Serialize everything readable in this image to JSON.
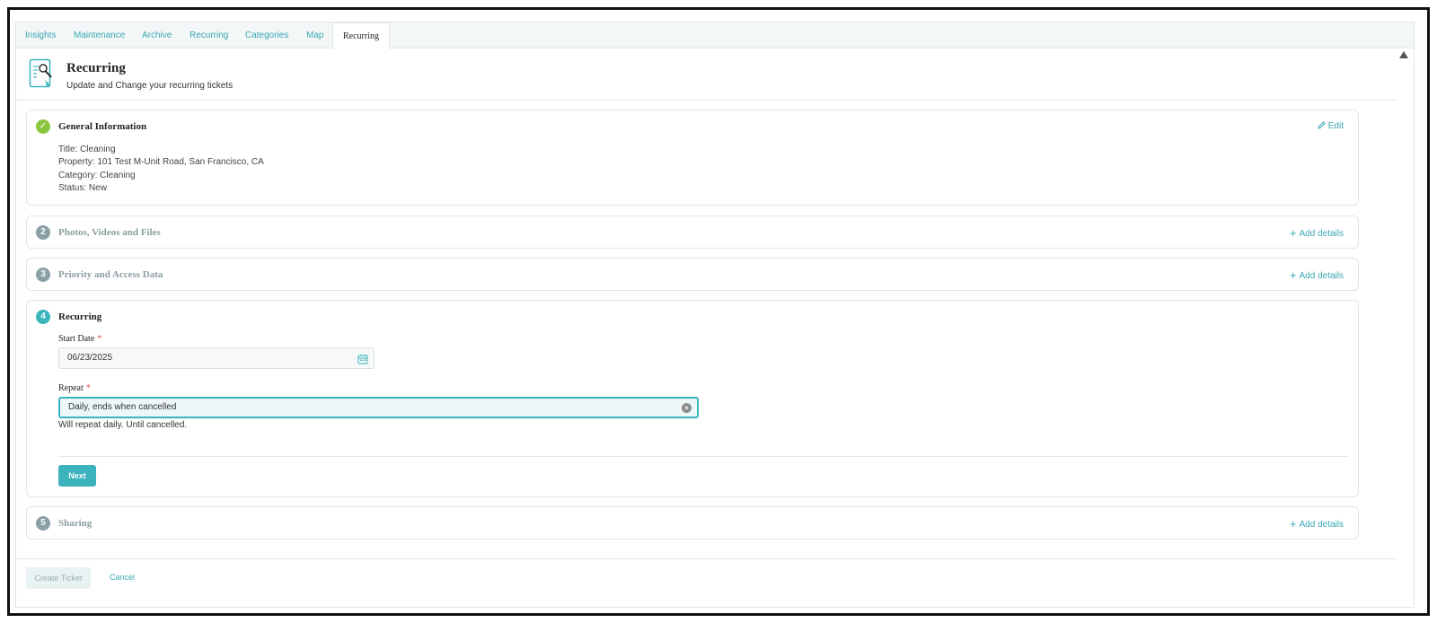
{
  "tabs": [
    {
      "label": "Insights",
      "active": false
    },
    {
      "label": "Maintenance",
      "active": false
    },
    {
      "label": "Archive",
      "active": false
    },
    {
      "label": "Recurring",
      "active": false
    },
    {
      "label": "Categories",
      "active": false
    },
    {
      "label": "Map",
      "active": false
    },
    {
      "label": "Recurring",
      "active": true
    }
  ],
  "header": {
    "icon": "wrench-document-icon",
    "title": "Recurring",
    "subtitle": "Update and Change your recurring tickets"
  },
  "sections": {
    "general": {
      "step": "✓",
      "title": "General Information",
      "action": "Edit",
      "action_icon": "pencil-icon",
      "lines": [
        "Title: Cleaning",
        "Property: 101 Test M-Unit Road, San Francisco, CA",
        "Category: Cleaning",
        "Status: New"
      ]
    },
    "photos": {
      "step": "2",
      "title": "Photos, Videos and Files",
      "action": "Add details"
    },
    "priority": {
      "step": "3",
      "title": "Priority and Access Data",
      "action": "Add details"
    },
    "recurring": {
      "step": "4",
      "title": "Recurring",
      "start_date_label": "Start Date",
      "start_date_value": "06/23/2025",
      "repeat_label": "Repeat",
      "repeat_value": "Daily,  ends when cancelled",
      "helper_text": "Will repeat daily. Until cancelled.",
      "required_mark": "*",
      "next_label": "Next"
    },
    "sharing": {
      "step": "5",
      "title": "Sharing",
      "action": "Add details"
    }
  },
  "footer": {
    "create_label": "Create Ticket",
    "cancel_label": "Cancel"
  },
  "colors": {
    "accent": "#3ab3bd",
    "link": "#3aa7b2",
    "done": "#8cc63f",
    "muted_badge": "#8aa0a4"
  }
}
